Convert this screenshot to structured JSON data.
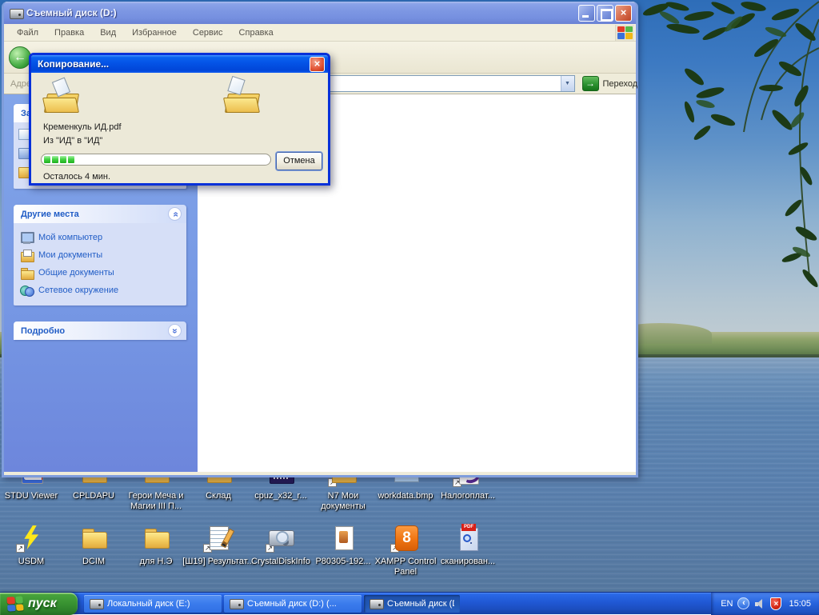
{
  "colors": {
    "taskbar_blue": "#2058d4",
    "start_green": "#389231",
    "active_title_blue": "#0453e6",
    "inactive_title_blue": "#7d97e3",
    "sidebar_blue": "#7698e4",
    "panel_body_blue": "#d6dff7",
    "panel_title_blue": "#215dc6",
    "progress_green": "#44d444",
    "dialog_beige": "#ece9d8"
  },
  "window": {
    "title": "Съемный диск (D:)",
    "close_glyph": "×",
    "menu": [
      "Файл",
      "Правка",
      "Вид",
      "Избранное",
      "Сервис",
      "Справка"
    ],
    "address": {
      "label": "Адрес",
      "go": "Переход"
    },
    "sidebar": {
      "tasks_panel": {
        "title": "Задачи для файлов и папок"
      },
      "other_places": {
        "title": "Другие места",
        "items": [
          {
            "label": "Мой компьютер",
            "icon": "my-computer-icon"
          },
          {
            "label": "Мои документы",
            "icon": "my-documents-icon"
          },
          {
            "label": "Общие документы",
            "icon": "shared-documents-icon"
          },
          {
            "label": "Сетевое окружение",
            "icon": "network-places-icon"
          }
        ]
      },
      "details_panel": {
        "title": "Подробно"
      }
    }
  },
  "dialog": {
    "title": "Копирование...",
    "close_glyph": "×",
    "file_name": "Кременкуль ИД.pdf",
    "route": "Из \"ИД\" в \"ИД\"",
    "progress_blocks": 4,
    "cancel_label": "Отмена",
    "remaining": "Осталось 4 мин."
  },
  "desktop": {
    "rows": [
      {
        "items": [
          {
            "label": "STDU Viewer",
            "icon": "stdu-viewer-icon",
            "shortcut": false
          },
          {
            "label": "CPLDAPU",
            "icon": "folder-icon",
            "shortcut": false
          },
          {
            "label": "Герои Меча и Магии III П...",
            "icon": "folder-icon",
            "shortcut": false
          },
          {
            "label": "Склад",
            "icon": "folder-icon",
            "shortcut": false
          },
          {
            "label": "cpuz_x32_r...",
            "icon": "cpuz-archive-icon",
            "shortcut": false
          },
          {
            "label": "N7 Мои документы",
            "icon": "folder-icon",
            "shortcut": true
          },
          {
            "label": "workdata.bmp",
            "icon": "bitmap-image-icon",
            "shortcut": false
          },
          {
            "label": "Налогоплат...",
            "icon": "nalog-app-icon",
            "shortcut": true
          }
        ]
      },
      {
        "items": [
          {
            "label": "USDM",
            "icon": "lightning-icon",
            "shortcut": true
          },
          {
            "label": "DCIM",
            "icon": "folder-icon",
            "shortcut": false
          },
          {
            "label": "для Н.Э",
            "icon": "folder-icon",
            "shortcut": false
          },
          {
            "label": "[Ш19] Результат...",
            "icon": "notepad-pencil-icon",
            "shortcut": true
          },
          {
            "label": "CrystalDiskInfo",
            "icon": "disk-info-icon",
            "shortcut": true
          },
          {
            "label": "P80305-192...",
            "icon": "document-icon",
            "shortcut": false
          },
          {
            "label": "XAMPP Control Panel",
            "icon": "xampp-icon",
            "shortcut": true
          },
          {
            "label": "сканирован...",
            "icon": "pdf-scan-icon",
            "shortcut": false
          }
        ]
      }
    ]
  },
  "taskbar": {
    "start": "пуск",
    "buttons": [
      {
        "label": "Локальный диск (E:)",
        "icon": "drive-icon",
        "active": false
      },
      {
        "label": "Съемный диск (D:) (...",
        "icon": "drive-icon",
        "active": false
      },
      {
        "label": "Съемный диск (D:)",
        "icon": "drive-icon",
        "active": true
      }
    ],
    "tray": {
      "language": "EN",
      "time": "15:05"
    }
  }
}
